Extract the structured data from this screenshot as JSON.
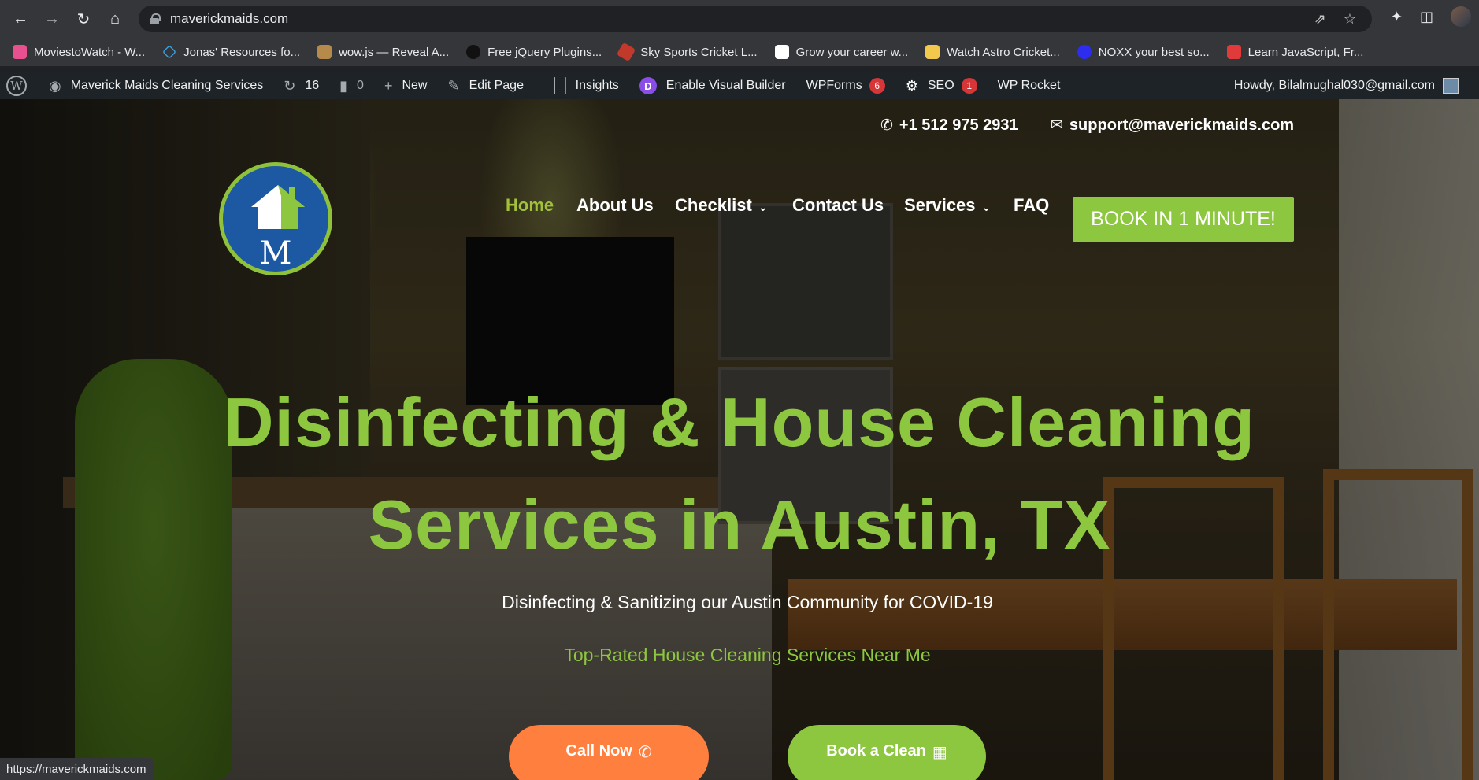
{
  "browser": {
    "url": "maverickmaids.com",
    "status_url": "https://maverickmaids.com"
  },
  "bookmarks": [
    {
      "label": "MoviestoWatch - W...",
      "color": "#e8508f"
    },
    {
      "label": "Jonas' Resources fo...",
      "color": "#3aa3e3"
    },
    {
      "label": "wow.js — Reveal A...",
      "color": "#b58a4a"
    },
    {
      "label": "Free jQuery Plugins...",
      "color": "#222222"
    },
    {
      "label": "Sky Sports Cricket L...",
      "color": "#c0392b"
    },
    {
      "label": "Grow your career w...",
      "color": "#ffffff"
    },
    {
      "label": "Watch Astro Cricket...",
      "color": "#f2c94c"
    },
    {
      "label": "NOXX your best so...",
      "color": "#2d2df0"
    },
    {
      "label": "Learn JavaScript, Fr...",
      "color": "#e03a3a"
    }
  ],
  "wpbar": {
    "site": "Maverick Maids Cleaning Services",
    "updates": "16",
    "comments": "0",
    "new": "New",
    "edit": "Edit Page",
    "insights": "Insights",
    "visual_builder": "Enable Visual Builder",
    "divi_letter": "D",
    "wpforms": "WPForms",
    "wpforms_count": "6",
    "seo": "SEO",
    "seo_count": "1",
    "rocket": "WP Rocket",
    "howdy": "Howdy, Bilalmughal030@gmail.com"
  },
  "site": {
    "phone": "+1 512 975 2931",
    "email": "support@maverickmaids.com",
    "nav": {
      "home": "Home",
      "about": "About Us",
      "checklist": "Checklist",
      "contact": "Contact Us",
      "services": "Services",
      "faq": "FAQ"
    },
    "book_button": "BOOK IN 1 MINUTE!",
    "headline_1": "Disinfecting & House Cleaning",
    "headline_2": "Services in Austin, TX",
    "subline": "Disinfecting & Sanitizing our Austin Community for COVID-19",
    "tagline": "Top-Rated House Cleaning Services Near Me",
    "cta_call": "Call Now",
    "cta_book": "Book a Clean",
    "colors": {
      "green": "#8dc63f",
      "orange": "#ff7f3f",
      "logo_blue": "#1d58a3"
    }
  }
}
